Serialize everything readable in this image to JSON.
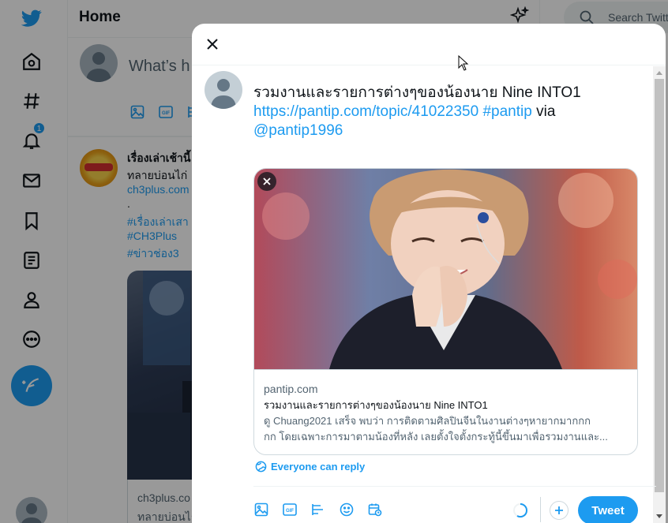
{
  "colors": {
    "accent": "#1d9bf0",
    "text": "#0f1419",
    "muted": "#536471",
    "border": "#cfd9de"
  },
  "nav": {
    "items": [
      {
        "icon": "twitter-logo-icon"
      },
      {
        "icon": "home-icon"
      },
      {
        "icon": "explore-hashtag-icon"
      },
      {
        "icon": "notifications-bell-icon",
        "badge": "1"
      },
      {
        "icon": "messages-envelope-icon"
      },
      {
        "icon": "bookmarks-icon"
      },
      {
        "icon": "lists-icon"
      },
      {
        "icon": "profile-icon"
      },
      {
        "icon": "more-icon"
      }
    ],
    "notification_badge": "1"
  },
  "main": {
    "title": "Home",
    "composer_placeholder": "What’s h",
    "feed": {
      "author": "เรื่องเล่าเช้านี้",
      "lines": [
        "ทลายบ่อนไก่",
        "ch3plus.com",
        ".",
        "#เรื่องเล่าเสา",
        "#CH3Plus",
        "#ข่าวช่อง3"
      ],
      "card_domain": "ch3plus.co",
      "card_desc": "ทลายบ่อนไก่"
    }
  },
  "right": {
    "search_placeholder": "Search Twitter"
  },
  "modal": {
    "tweet_text": "รวมงานและรายการต่างๆของน้องนาย Nine INTO1",
    "link": "https://pantip.com/topic/41022350",
    "hashtag": "#pantip",
    "via": "via",
    "mention": "@pantip1996",
    "card": {
      "domain": "pantip.com",
      "title": "รวมงานและรายการต่างๆของน้องนาย Nine INTO1",
      "desc_line1": "ดู Chuang2021 เสร็จ พบว่า การติดตามศิลปินจีนในงานต่างๆหายากมากกก",
      "desc_line2": "กก โดยเฉพาะการมาตามน้องที่หลัง เลยตั้งใจตั้งกระทู้นี้ขึ้นมาเพื่อรวมงานและ..."
    },
    "reply_setting": "Everyone can reply",
    "tweet_button": "Tweet"
  }
}
